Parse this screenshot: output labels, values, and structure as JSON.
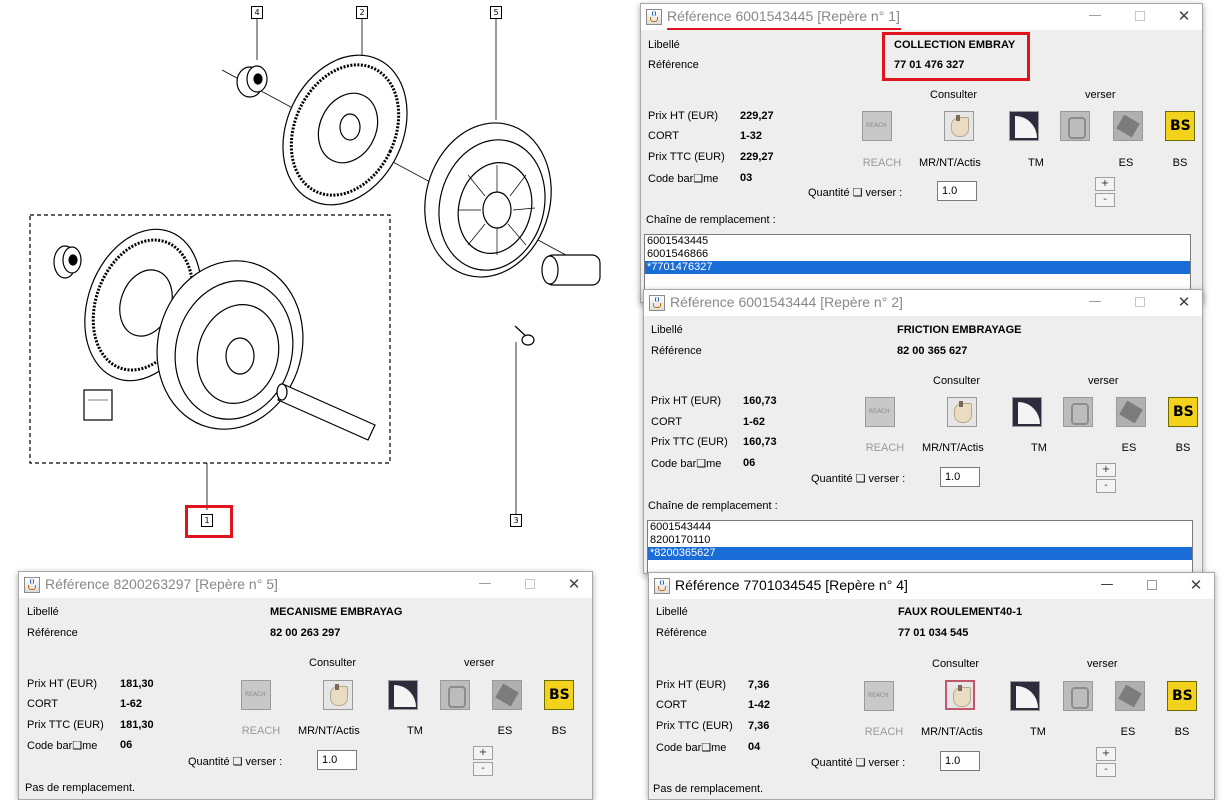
{
  "diagram": {
    "callouts": [
      "4",
      "2",
      "5",
      "1",
      "3"
    ]
  },
  "labels": {
    "libelle": "Libellé",
    "reference": "Référence",
    "prix_ht": "Prix HT (EUR)",
    "cort": "CORT",
    "prix_ttc": "Prix TTC (EUR)",
    "code_bareme": "Code bar❑me",
    "consulter": "Consulter",
    "verser": "verser",
    "quantite": "Quantité ❑ verser :",
    "chaine": "Chaîne de remplacement :",
    "plus": "+",
    "minus": "-",
    "icons": [
      "REACH",
      "MR/NT/Actis",
      "TM",
      "ES",
      "BS"
    ]
  },
  "windows": [
    {
      "title": "Référence 6001543445 [Repère n° 1]",
      "libelle": "COLLECTION EMBRAY",
      "reference": "77 01 476 327",
      "prix_ht": "229,27",
      "cort": "1-32",
      "prix_ttc": "229,27",
      "code_bareme": "03",
      "quantite": "1.0",
      "chain": [
        "6001543445",
        "6001546866",
        "*7701476327"
      ],
      "selected_index": 2
    },
    {
      "title": "Référence 6001543444 [Repère n° 2]",
      "libelle": "FRICTION EMBRAYAGE",
      "reference": "82 00 365 627",
      "prix_ht": "160,73",
      "cort": "1-62",
      "prix_ttc": "160,73",
      "code_bareme": "06",
      "quantite": "1.0",
      "chain": [
        "6001543444",
        "8200170110",
        "*8200365627"
      ],
      "selected_index": 2
    },
    {
      "title": "Référence 8200263297 [Repère n° 5]",
      "libelle": "MECANISME EMBRAYAG",
      "reference": "82 00 263 297",
      "prix_ht": "181,30",
      "cort": "1-62",
      "prix_ttc": "181,30",
      "code_bareme": "06",
      "quantite": "1.0",
      "no_replacement": "Pas de remplacement."
    },
    {
      "title": "Référence 7701034545 [Repère n° 4]",
      "libelle": "FAUX ROULEMENT40-1",
      "reference": "77 01 034 545",
      "prix_ht": "7,36",
      "cort": "1-42",
      "prix_ttc": "7,36",
      "code_bareme": "04",
      "quantite": "1.0",
      "no_replacement": "Pas de remplacement."
    }
  ],
  "colors": {
    "accent_red": "#e0141e",
    "selection_blue": "#1a6cd6",
    "window_bg": "#eeeeee"
  }
}
